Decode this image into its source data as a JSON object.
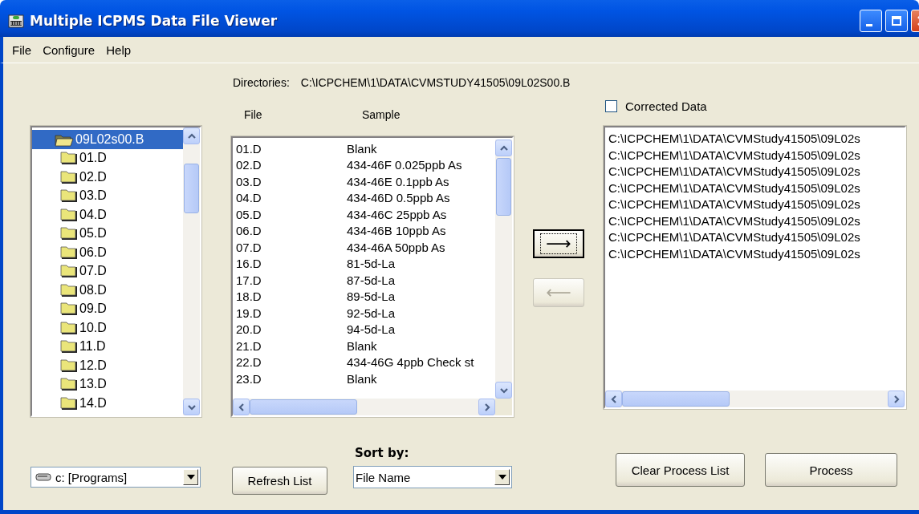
{
  "window": {
    "title": "Multiple ICPMS Data File Viewer"
  },
  "menu": [
    "File",
    "Configure",
    "Help"
  ],
  "directories": {
    "label": "Directories:",
    "path": "C:\\ICPCHEM\\1\\DATA\\CVMSTUDY41505\\09L02S00.B"
  },
  "folder_tree": {
    "items": [
      {
        "label": "09L02s00.B",
        "selected": true,
        "expanded": true,
        "children": [
          {
            "label": "01.D",
            "selected": false,
            "expanded": false
          },
          {
            "label": "02.D",
            "selected": false,
            "expanded": false
          },
          {
            "label": "03.D",
            "selected": false,
            "expanded": false
          },
          {
            "label": "04.D",
            "selected": false,
            "expanded": false
          },
          {
            "label": "05.D",
            "selected": false,
            "expanded": false
          },
          {
            "label": "06.D",
            "selected": false,
            "expanded": false
          },
          {
            "label": "07.D",
            "selected": false,
            "expanded": false
          },
          {
            "label": "08.D",
            "selected": false,
            "expanded": false
          },
          {
            "label": "09.D",
            "selected": false,
            "expanded": false
          },
          {
            "label": "10.D",
            "selected": false,
            "expanded": false
          },
          {
            "label": "11.D",
            "selected": false,
            "expanded": false
          },
          {
            "label": "12.D",
            "selected": false,
            "expanded": false
          },
          {
            "label": "13.D",
            "selected": false,
            "expanded": false
          },
          {
            "label": "14.D",
            "selected": false,
            "expanded": false
          }
        ]
      }
    ]
  },
  "file_list": {
    "columns": [
      "File",
      "Sample"
    ],
    "rows": [
      {
        "file": "01.D",
        "sample": "Blank",
        "selected": false
      },
      {
        "file": "02.D",
        "sample": "434-46F 0.025ppb As",
        "selected": false
      },
      {
        "file": "03.D",
        "sample": "434-46E 0.1ppb As",
        "selected": false
      },
      {
        "file": "04.D",
        "sample": "434-46D 0.5ppb As",
        "selected": false
      },
      {
        "file": "05.D",
        "sample": "434-46C 25ppb As",
        "selected": false
      },
      {
        "file": "06.D",
        "sample": "434-46B 10ppb As",
        "selected": false
      },
      {
        "file": "07.D",
        "sample": "434-46A 50ppb As",
        "selected": false
      },
      {
        "file": "16.D",
        "sample": "81-5d-La",
        "selected": false
      },
      {
        "file": "17.D",
        "sample": "87-5d-La",
        "selected": false
      },
      {
        "file": "18.D",
        "sample": "89-5d-La",
        "selected": false
      },
      {
        "file": "19.D",
        "sample": "92-5d-La",
        "selected": false
      },
      {
        "file": "20.D",
        "sample": "94-5d-La",
        "selected": false
      },
      {
        "file": "21.D",
        "sample": "Blank",
        "selected": false
      },
      {
        "file": "22.D",
        "sample": "434-46G 4ppb Check st",
        "selected": false
      },
      {
        "file": "23.D",
        "sample": "Blank",
        "selected": false
      }
    ]
  },
  "transfer_buttons": [
    {
      "label": "⟶",
      "disabled": false,
      "focused": true
    },
    {
      "label": "⟵",
      "disabled": true,
      "focused": false
    }
  ],
  "corrected_data": {
    "label": "Corrected Data",
    "checked": false
  },
  "process_list": {
    "rows": [
      {
        "path": "C:\\ICPCHEM\\1\\DATA\\CVMStudy41505\\09L02s",
        "selected": false
      },
      {
        "path": "C:\\ICPCHEM\\1\\DATA\\CVMStudy41505\\09L02s",
        "selected": false
      },
      {
        "path": "C:\\ICPCHEM\\1\\DATA\\CVMStudy41505\\09L02s",
        "selected": false
      },
      {
        "path": "C:\\ICPCHEM\\1\\DATA\\CVMStudy41505\\09L02s",
        "selected": false
      },
      {
        "path": "C:\\ICPCHEM\\1\\DATA\\CVMStudy41505\\09L02s",
        "selected": false
      },
      {
        "path": "C:\\ICPCHEM\\1\\DATA\\CVMStudy41505\\09L02s",
        "selected": false
      },
      {
        "path": "C:\\ICPCHEM\\1\\DATA\\CVMStudy41505\\09L02s",
        "selected": false
      },
      {
        "path": "C:\\ICPCHEM\\1\\DATA\\CVMStudy41505\\09L02s",
        "selected": false
      }
    ]
  },
  "drive": {
    "value": "c: [Programs]"
  },
  "refresh_button": "Refresh List",
  "sort_by": {
    "label": "Sort by:",
    "value": "File Name"
  },
  "actions": [
    "Clear Process List",
    "Process"
  ]
}
